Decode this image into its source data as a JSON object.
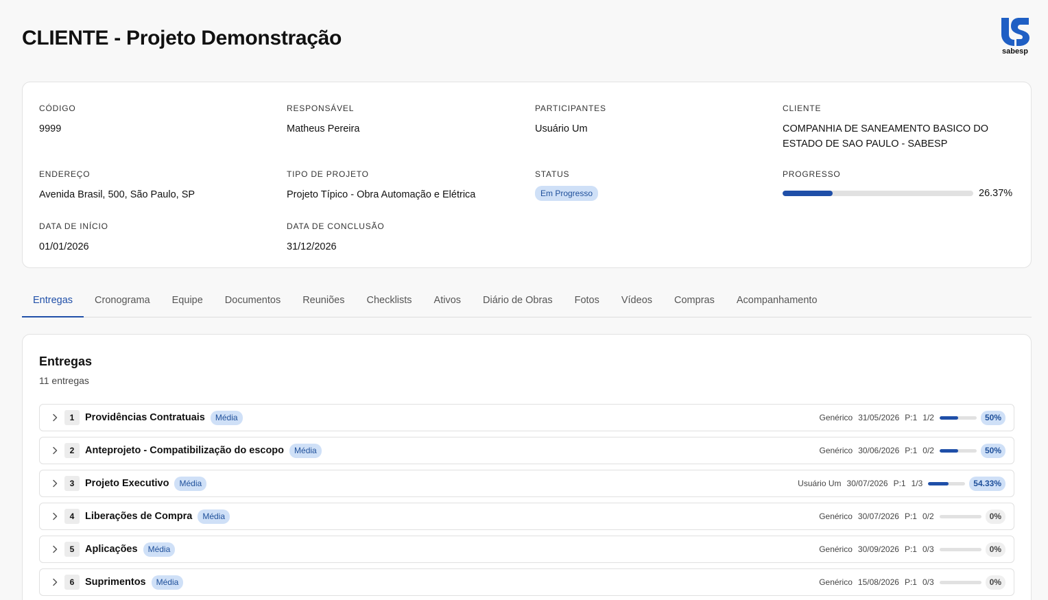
{
  "header": {
    "title": "CLIENTE - Projeto Demonstração",
    "logo_text": "sabesp"
  },
  "info": {
    "codigo_label": "CÓDIGO",
    "codigo": "9999",
    "responsavel_label": "RESPONSÁVEL",
    "responsavel": "Matheus Pereira",
    "participantes_label": "PARTICIPANTES",
    "participantes": "Usuário Um",
    "cliente_label": "CLIENTE",
    "cliente_line1": "COMPANHIA DE SANEAMENTO BASICO DO",
    "cliente_line2": "ESTADO DE SAO PAULO - SABESP",
    "endereco_label": "ENDEREÇO",
    "endereco": "Avenida Brasil, 500, São Paulo, SP",
    "tipo_label": "TIPO DE PROJETO",
    "tipo": "Projeto Típico - Obra Automação e Elétrica",
    "status_label": "STATUS",
    "status": "Em Progresso",
    "progresso_label": "PROGRESSO",
    "progresso_text": "26.37%",
    "progresso_value": 26.37,
    "inicio_label": "DATA DE INÍCIO",
    "inicio": "01/01/2026",
    "conclusao_label": "DATA DE CONCLUSÃO",
    "conclusao": "31/12/2026"
  },
  "tabs": [
    {
      "label": "Entregas",
      "active": true
    },
    {
      "label": "Cronograma"
    },
    {
      "label": "Equipe"
    },
    {
      "label": "Documentos"
    },
    {
      "label": "Reuniões"
    },
    {
      "label": "Checklists"
    },
    {
      "label": "Ativos"
    },
    {
      "label": "Diário de Obras"
    },
    {
      "label": "Fotos"
    },
    {
      "label": "Vídeos"
    },
    {
      "label": "Compras"
    },
    {
      "label": "Acompanhamento"
    }
  ],
  "deliveries": {
    "title": "Entregas",
    "count": "11 entregas",
    "items": [
      {
        "num": "1",
        "name": "Providências Contratuais",
        "priority": "Média",
        "owner": "Genérico",
        "date": "31/05/2026",
        "p": "P:1",
        "ratio": "1/2",
        "pct": "50%",
        "progress": 50
      },
      {
        "num": "2",
        "name": "Anteprojeto - Compatibilização do escopo",
        "priority": "Média",
        "owner": "Genérico",
        "date": "30/06/2026",
        "p": "P:1",
        "ratio": "0/2",
        "pct": "50%",
        "progress": 50
      },
      {
        "num": "3",
        "name": "Projeto Executivo",
        "priority": "Média",
        "owner": "Usuário Um",
        "date": "30/07/2026",
        "p": "P:1",
        "ratio": "1/3",
        "pct": "54.33%",
        "progress": 54.33
      },
      {
        "num": "4",
        "name": "Liberações de Compra",
        "priority": "Média",
        "owner": "Genérico",
        "date": "30/07/2026",
        "p": "P:1",
        "ratio": "0/2",
        "pct": "0%",
        "progress": 0
      },
      {
        "num": "5",
        "name": "Aplicações",
        "priority": "Média",
        "owner": "Genérico",
        "date": "30/09/2026",
        "p": "P:1",
        "ratio": "0/3",
        "pct": "0%",
        "progress": 0
      },
      {
        "num": "6",
        "name": "Suprimentos",
        "priority": "Média",
        "owner": "Genérico",
        "date": "15/08/2026",
        "p": "P:1",
        "ratio": "0/3",
        "pct": "0%",
        "progress": 0
      }
    ]
  },
  "colors": {
    "accent": "#1f4fa8",
    "badge_bg": "#cfe0f7",
    "badge_text": "#1e4f9a"
  }
}
